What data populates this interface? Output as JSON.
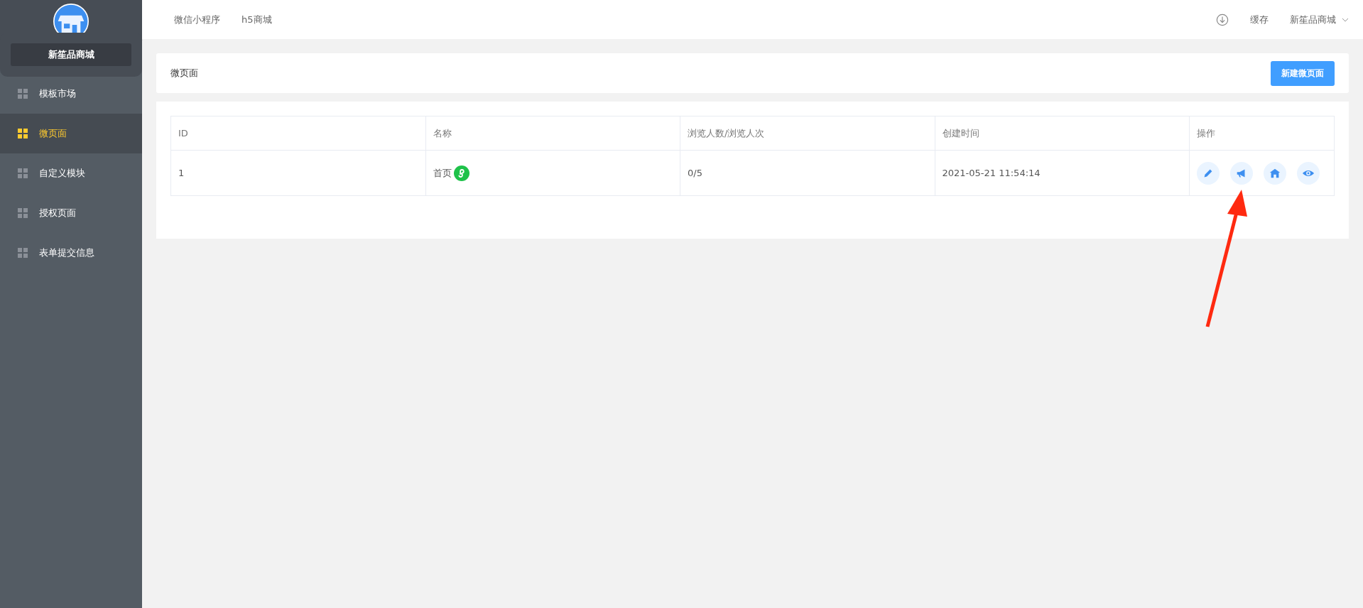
{
  "sidebar": {
    "store_name": "新笙品商城",
    "items": [
      {
        "label": "模板市场",
        "selected": false
      },
      {
        "label": "微页面",
        "selected": true
      },
      {
        "label": "自定义模块",
        "selected": false
      },
      {
        "label": "授权页面",
        "selected": false
      },
      {
        "label": "表单提交信息",
        "selected": false
      }
    ]
  },
  "topbar": {
    "tabs": [
      "微信小程序",
      "h5商城"
    ],
    "cache": "缓存",
    "account": "新笙品商城"
  },
  "page_header": {
    "title": "微页面",
    "new_button": "新建微页面"
  },
  "table": {
    "columns": [
      "ID",
      "名称",
      "浏览人数/浏览人次",
      "创建时间",
      "操作"
    ],
    "rows": [
      {
        "id": "1",
        "name": "首页",
        "views": "0/5",
        "created": "2021-05-21 11:54:14",
        "actions": [
          {
            "kind": "edit"
          },
          {
            "kind": "promote"
          },
          {
            "kind": "home"
          },
          {
            "kind": "preview"
          }
        ]
      }
    ]
  }
}
